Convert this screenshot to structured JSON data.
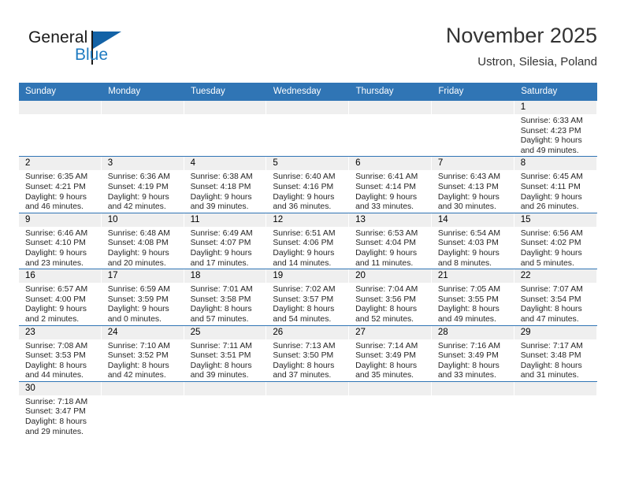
{
  "brand": {
    "name_part1": "General",
    "name_part2": "Blue",
    "flag_icon": "blue-flag-icon",
    "accent_color": "#1362a6"
  },
  "header": {
    "title": "November 2025",
    "subtitle": "Ustron, Silesia, Poland"
  },
  "colors": {
    "header_bar": "#3075b5",
    "daynum_band": "#efefef",
    "row_divider": "#3075b5",
    "brand_blue": "#1f7bc1"
  },
  "calendar": {
    "weekday_headers": [
      "Sunday",
      "Monday",
      "Tuesday",
      "Wednesday",
      "Thursday",
      "Friday",
      "Saturday"
    ],
    "weeks": [
      [
        {
          "day": "",
          "sunrise": "",
          "sunset": "",
          "daylight_line1": "",
          "daylight_line2": ""
        },
        {
          "day": "",
          "sunrise": "",
          "sunset": "",
          "daylight_line1": "",
          "daylight_line2": ""
        },
        {
          "day": "",
          "sunrise": "",
          "sunset": "",
          "daylight_line1": "",
          "daylight_line2": ""
        },
        {
          "day": "",
          "sunrise": "",
          "sunset": "",
          "daylight_line1": "",
          "daylight_line2": ""
        },
        {
          "day": "",
          "sunrise": "",
          "sunset": "",
          "daylight_line1": "",
          "daylight_line2": ""
        },
        {
          "day": "",
          "sunrise": "",
          "sunset": "",
          "daylight_line1": "",
          "daylight_line2": ""
        },
        {
          "day": "1",
          "sunrise": "Sunrise: 6:33 AM",
          "sunset": "Sunset: 4:23 PM",
          "daylight_line1": "Daylight: 9 hours",
          "daylight_line2": "and 49 minutes."
        }
      ],
      [
        {
          "day": "2",
          "sunrise": "Sunrise: 6:35 AM",
          "sunset": "Sunset: 4:21 PM",
          "daylight_line1": "Daylight: 9 hours",
          "daylight_line2": "and 46 minutes."
        },
        {
          "day": "3",
          "sunrise": "Sunrise: 6:36 AM",
          "sunset": "Sunset: 4:19 PM",
          "daylight_line1": "Daylight: 9 hours",
          "daylight_line2": "and 42 minutes."
        },
        {
          "day": "4",
          "sunrise": "Sunrise: 6:38 AM",
          "sunset": "Sunset: 4:18 PM",
          "daylight_line1": "Daylight: 9 hours",
          "daylight_line2": "and 39 minutes."
        },
        {
          "day": "5",
          "sunrise": "Sunrise: 6:40 AM",
          "sunset": "Sunset: 4:16 PM",
          "daylight_line1": "Daylight: 9 hours",
          "daylight_line2": "and 36 minutes."
        },
        {
          "day": "6",
          "sunrise": "Sunrise: 6:41 AM",
          "sunset": "Sunset: 4:14 PM",
          "daylight_line1": "Daylight: 9 hours",
          "daylight_line2": "and 33 minutes."
        },
        {
          "day": "7",
          "sunrise": "Sunrise: 6:43 AM",
          "sunset": "Sunset: 4:13 PM",
          "daylight_line1": "Daylight: 9 hours",
          "daylight_line2": "and 30 minutes."
        },
        {
          "day": "8",
          "sunrise": "Sunrise: 6:45 AM",
          "sunset": "Sunset: 4:11 PM",
          "daylight_line1": "Daylight: 9 hours",
          "daylight_line2": "and 26 minutes."
        }
      ],
      [
        {
          "day": "9",
          "sunrise": "Sunrise: 6:46 AM",
          "sunset": "Sunset: 4:10 PM",
          "daylight_line1": "Daylight: 9 hours",
          "daylight_line2": "and 23 minutes."
        },
        {
          "day": "10",
          "sunrise": "Sunrise: 6:48 AM",
          "sunset": "Sunset: 4:08 PM",
          "daylight_line1": "Daylight: 9 hours",
          "daylight_line2": "and 20 minutes."
        },
        {
          "day": "11",
          "sunrise": "Sunrise: 6:49 AM",
          "sunset": "Sunset: 4:07 PM",
          "daylight_line1": "Daylight: 9 hours",
          "daylight_line2": "and 17 minutes."
        },
        {
          "day": "12",
          "sunrise": "Sunrise: 6:51 AM",
          "sunset": "Sunset: 4:06 PM",
          "daylight_line1": "Daylight: 9 hours",
          "daylight_line2": "and 14 minutes."
        },
        {
          "day": "13",
          "sunrise": "Sunrise: 6:53 AM",
          "sunset": "Sunset: 4:04 PM",
          "daylight_line1": "Daylight: 9 hours",
          "daylight_line2": "and 11 minutes."
        },
        {
          "day": "14",
          "sunrise": "Sunrise: 6:54 AM",
          "sunset": "Sunset: 4:03 PM",
          "daylight_line1": "Daylight: 9 hours",
          "daylight_line2": "and 8 minutes."
        },
        {
          "day": "15",
          "sunrise": "Sunrise: 6:56 AM",
          "sunset": "Sunset: 4:02 PM",
          "daylight_line1": "Daylight: 9 hours",
          "daylight_line2": "and 5 minutes."
        }
      ],
      [
        {
          "day": "16",
          "sunrise": "Sunrise: 6:57 AM",
          "sunset": "Sunset: 4:00 PM",
          "daylight_line1": "Daylight: 9 hours",
          "daylight_line2": "and 2 minutes."
        },
        {
          "day": "17",
          "sunrise": "Sunrise: 6:59 AM",
          "sunset": "Sunset: 3:59 PM",
          "daylight_line1": "Daylight: 9 hours",
          "daylight_line2": "and 0 minutes."
        },
        {
          "day": "18",
          "sunrise": "Sunrise: 7:01 AM",
          "sunset": "Sunset: 3:58 PM",
          "daylight_line1": "Daylight: 8 hours",
          "daylight_line2": "and 57 minutes."
        },
        {
          "day": "19",
          "sunrise": "Sunrise: 7:02 AM",
          "sunset": "Sunset: 3:57 PM",
          "daylight_line1": "Daylight: 8 hours",
          "daylight_line2": "and 54 minutes."
        },
        {
          "day": "20",
          "sunrise": "Sunrise: 7:04 AM",
          "sunset": "Sunset: 3:56 PM",
          "daylight_line1": "Daylight: 8 hours",
          "daylight_line2": "and 52 minutes."
        },
        {
          "day": "21",
          "sunrise": "Sunrise: 7:05 AM",
          "sunset": "Sunset: 3:55 PM",
          "daylight_line1": "Daylight: 8 hours",
          "daylight_line2": "and 49 minutes."
        },
        {
          "day": "22",
          "sunrise": "Sunrise: 7:07 AM",
          "sunset": "Sunset: 3:54 PM",
          "daylight_line1": "Daylight: 8 hours",
          "daylight_line2": "and 47 minutes."
        }
      ],
      [
        {
          "day": "23",
          "sunrise": "Sunrise: 7:08 AM",
          "sunset": "Sunset: 3:53 PM",
          "daylight_line1": "Daylight: 8 hours",
          "daylight_line2": "and 44 minutes."
        },
        {
          "day": "24",
          "sunrise": "Sunrise: 7:10 AM",
          "sunset": "Sunset: 3:52 PM",
          "daylight_line1": "Daylight: 8 hours",
          "daylight_line2": "and 42 minutes."
        },
        {
          "day": "25",
          "sunrise": "Sunrise: 7:11 AM",
          "sunset": "Sunset: 3:51 PM",
          "daylight_line1": "Daylight: 8 hours",
          "daylight_line2": "and 39 minutes."
        },
        {
          "day": "26",
          "sunrise": "Sunrise: 7:13 AM",
          "sunset": "Sunset: 3:50 PM",
          "daylight_line1": "Daylight: 8 hours",
          "daylight_line2": "and 37 minutes."
        },
        {
          "day": "27",
          "sunrise": "Sunrise: 7:14 AM",
          "sunset": "Sunset: 3:49 PM",
          "daylight_line1": "Daylight: 8 hours",
          "daylight_line2": "and 35 minutes."
        },
        {
          "day": "28",
          "sunrise": "Sunrise: 7:16 AM",
          "sunset": "Sunset: 3:49 PM",
          "daylight_line1": "Daylight: 8 hours",
          "daylight_line2": "and 33 minutes."
        },
        {
          "day": "29",
          "sunrise": "Sunrise: 7:17 AM",
          "sunset": "Sunset: 3:48 PM",
          "daylight_line1": "Daylight: 8 hours",
          "daylight_line2": "and 31 minutes."
        }
      ],
      [
        {
          "day": "30",
          "sunrise": "Sunrise: 7:18 AM",
          "sunset": "Sunset: 3:47 PM",
          "daylight_line1": "Daylight: 8 hours",
          "daylight_line2": "and 29 minutes."
        },
        {
          "day": "",
          "sunrise": "",
          "sunset": "",
          "daylight_line1": "",
          "daylight_line2": ""
        },
        {
          "day": "",
          "sunrise": "",
          "sunset": "",
          "daylight_line1": "",
          "daylight_line2": ""
        },
        {
          "day": "",
          "sunrise": "",
          "sunset": "",
          "daylight_line1": "",
          "daylight_line2": ""
        },
        {
          "day": "",
          "sunrise": "",
          "sunset": "",
          "daylight_line1": "",
          "daylight_line2": ""
        },
        {
          "day": "",
          "sunrise": "",
          "sunset": "",
          "daylight_line1": "",
          "daylight_line2": ""
        },
        {
          "day": "",
          "sunrise": "",
          "sunset": "",
          "daylight_line1": "",
          "daylight_line2": ""
        }
      ]
    ]
  }
}
